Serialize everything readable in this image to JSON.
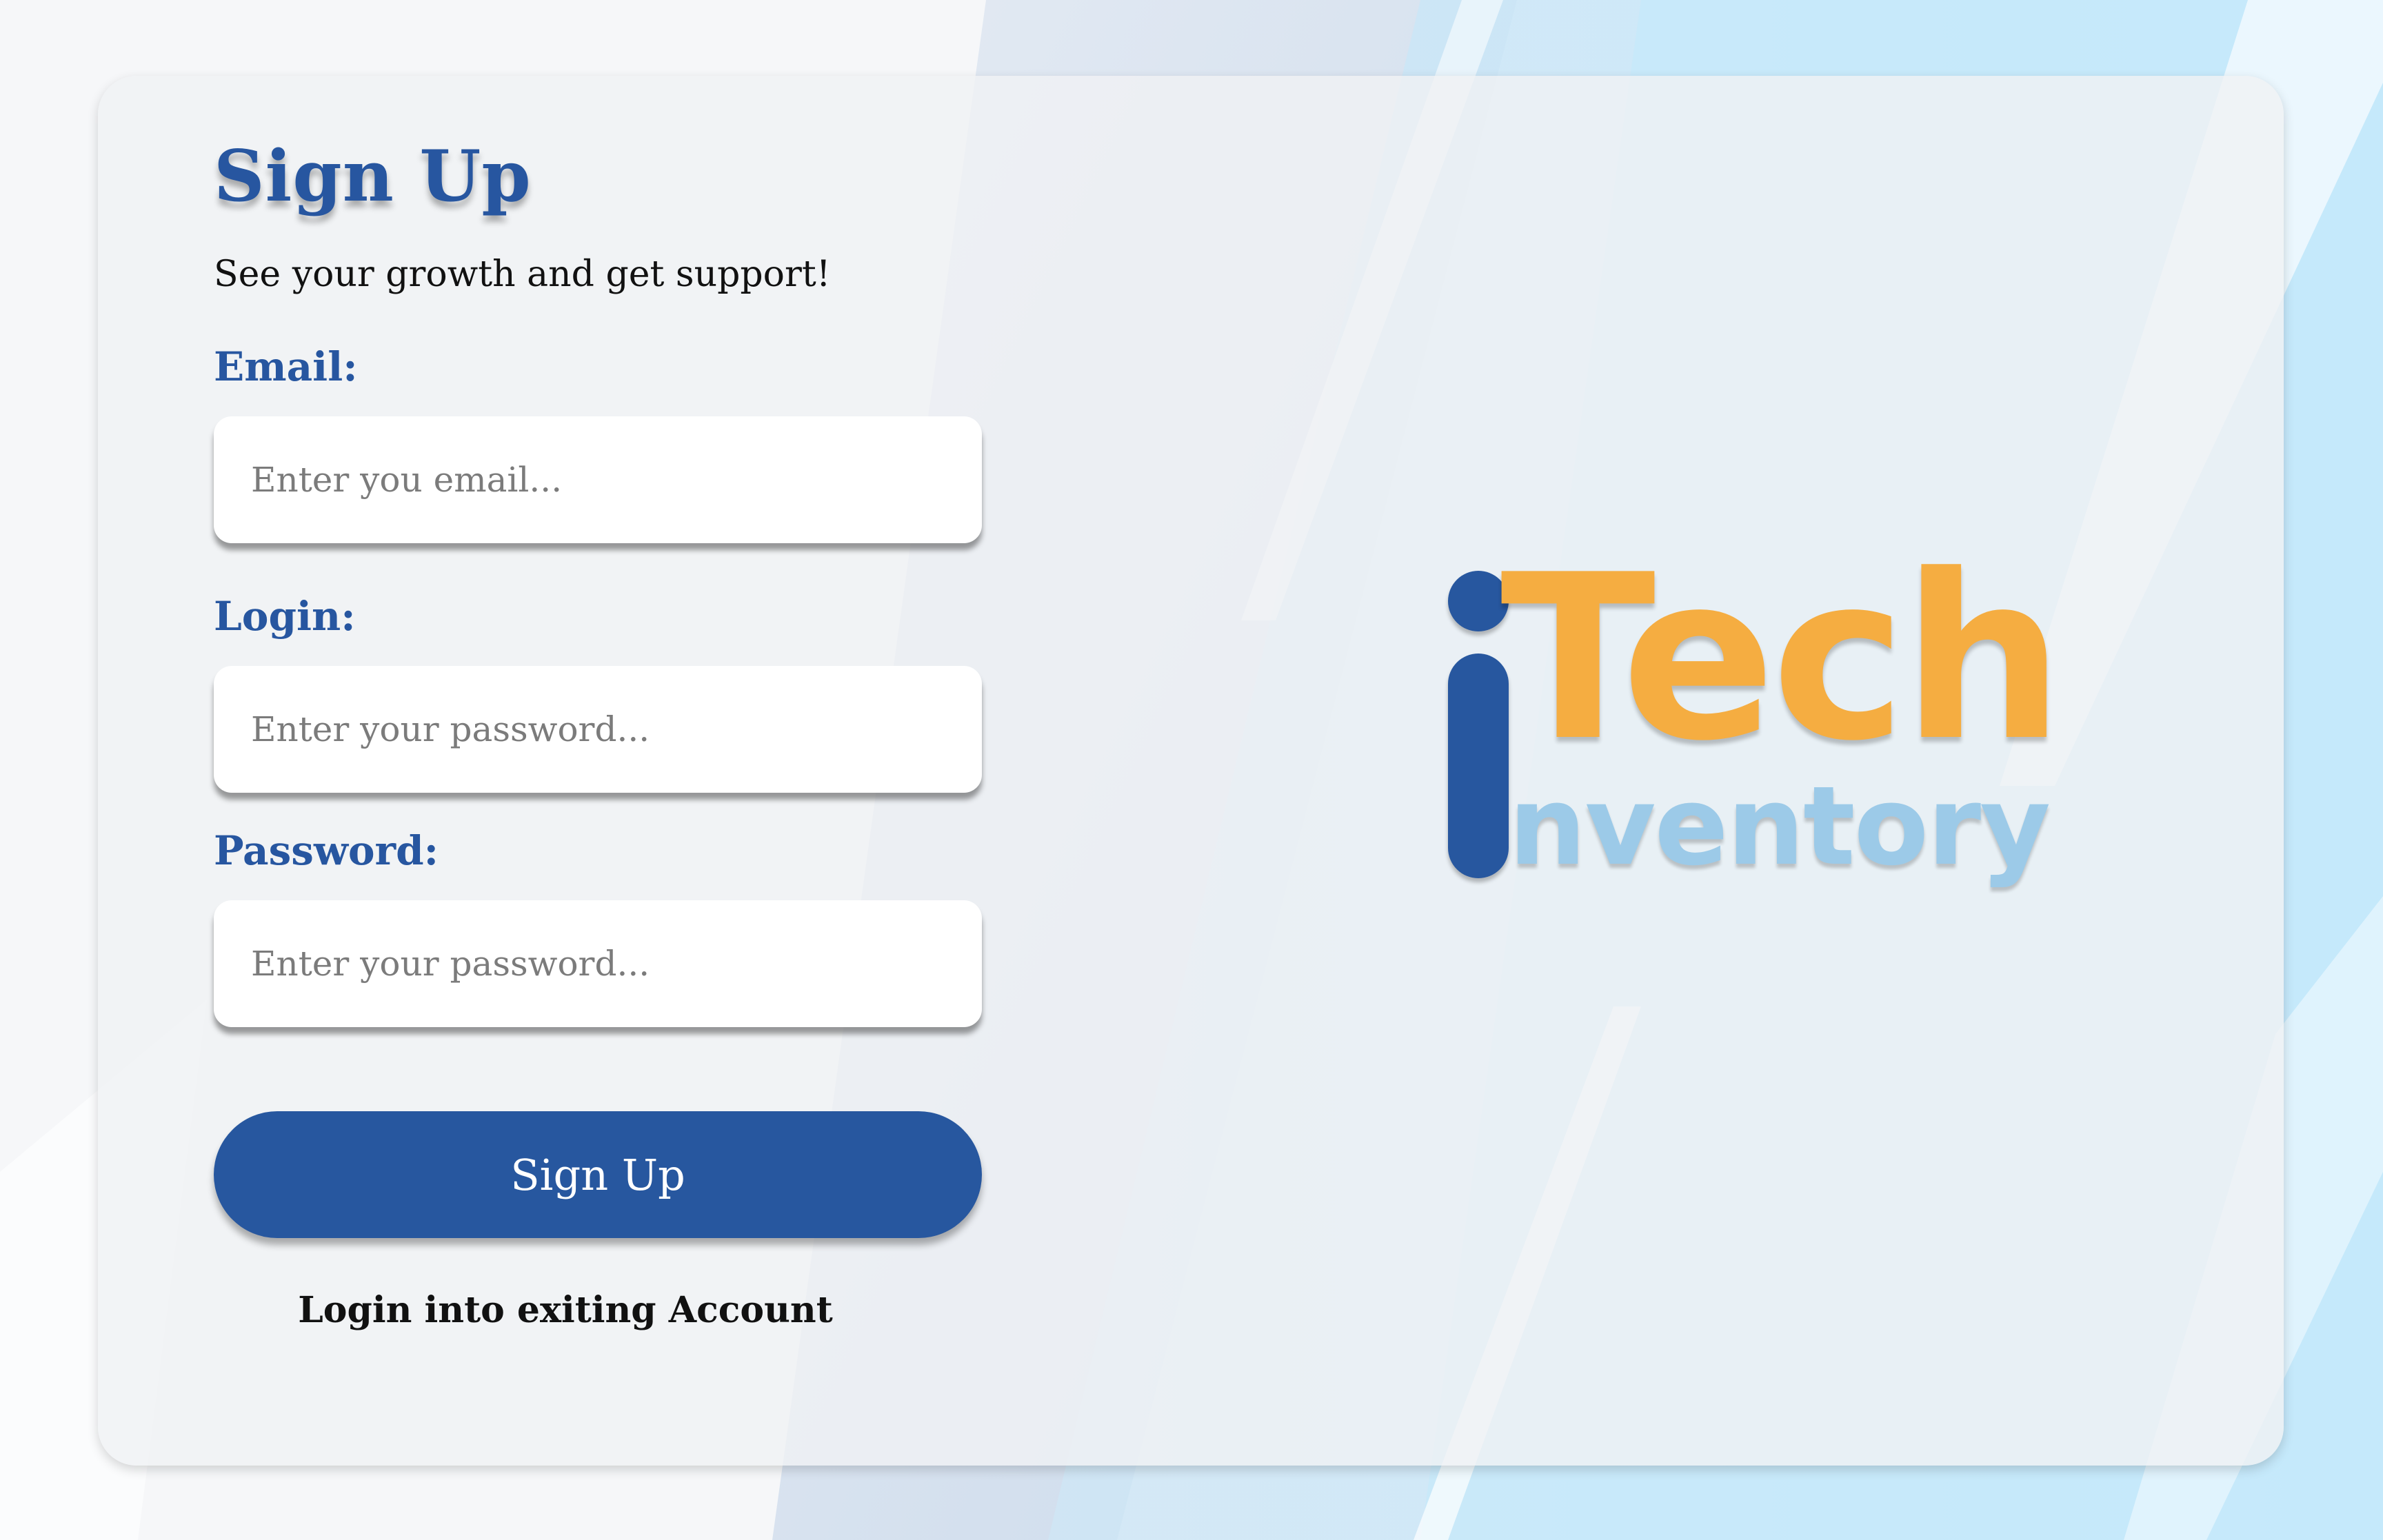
{
  "page": {
    "title": "Sign Up",
    "subtitle": "See your growth and get support!"
  },
  "form": {
    "email": {
      "label": "Email:",
      "placeholder": "Enter you email..."
    },
    "login": {
      "label": "Login:",
      "placeholder": "Enter your password..."
    },
    "password": {
      "label": "Password:",
      "placeholder": "Enter your password..."
    },
    "submit_label": "Sign Up",
    "login_link": "Login into exiting Account"
  },
  "logo": {
    "word_tech": "Tech",
    "word_inventory": "nventory",
    "icon": "letter-i-mark"
  },
  "colors": {
    "brand_blue": "#27579f",
    "logo_orange": "#f5ad41",
    "logo_light_blue": "#9ccae8",
    "card_background": "#f0f1f4"
  }
}
